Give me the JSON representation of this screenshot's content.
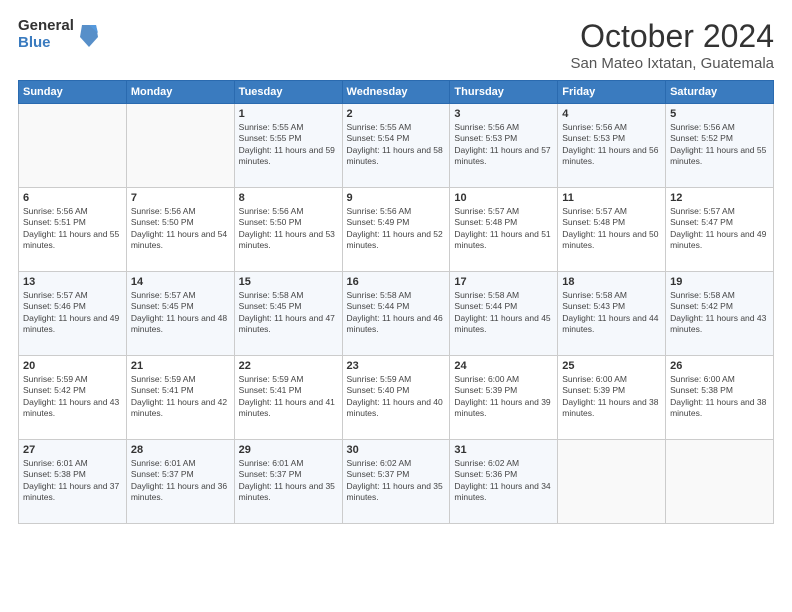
{
  "logo": {
    "general": "General",
    "blue": "Blue"
  },
  "header": {
    "month": "October 2024",
    "location": "San Mateo Ixtatan, Guatemala"
  },
  "weekdays": [
    "Sunday",
    "Monday",
    "Tuesday",
    "Wednesday",
    "Thursday",
    "Friday",
    "Saturday"
  ],
  "weeks": [
    [
      {
        "day": "",
        "info": ""
      },
      {
        "day": "",
        "info": ""
      },
      {
        "day": "1",
        "info": "Sunrise: 5:55 AM\nSunset: 5:55 PM\nDaylight: 11 hours and 59 minutes."
      },
      {
        "day": "2",
        "info": "Sunrise: 5:55 AM\nSunset: 5:54 PM\nDaylight: 11 hours and 58 minutes."
      },
      {
        "day": "3",
        "info": "Sunrise: 5:56 AM\nSunset: 5:53 PM\nDaylight: 11 hours and 57 minutes."
      },
      {
        "day": "4",
        "info": "Sunrise: 5:56 AM\nSunset: 5:53 PM\nDaylight: 11 hours and 56 minutes."
      },
      {
        "day": "5",
        "info": "Sunrise: 5:56 AM\nSunset: 5:52 PM\nDaylight: 11 hours and 55 minutes."
      }
    ],
    [
      {
        "day": "6",
        "info": "Sunrise: 5:56 AM\nSunset: 5:51 PM\nDaylight: 11 hours and 55 minutes."
      },
      {
        "day": "7",
        "info": "Sunrise: 5:56 AM\nSunset: 5:50 PM\nDaylight: 11 hours and 54 minutes."
      },
      {
        "day": "8",
        "info": "Sunrise: 5:56 AM\nSunset: 5:50 PM\nDaylight: 11 hours and 53 minutes."
      },
      {
        "day": "9",
        "info": "Sunrise: 5:56 AM\nSunset: 5:49 PM\nDaylight: 11 hours and 52 minutes."
      },
      {
        "day": "10",
        "info": "Sunrise: 5:57 AM\nSunset: 5:48 PM\nDaylight: 11 hours and 51 minutes."
      },
      {
        "day": "11",
        "info": "Sunrise: 5:57 AM\nSunset: 5:48 PM\nDaylight: 11 hours and 50 minutes."
      },
      {
        "day": "12",
        "info": "Sunrise: 5:57 AM\nSunset: 5:47 PM\nDaylight: 11 hours and 49 minutes."
      }
    ],
    [
      {
        "day": "13",
        "info": "Sunrise: 5:57 AM\nSunset: 5:46 PM\nDaylight: 11 hours and 49 minutes."
      },
      {
        "day": "14",
        "info": "Sunrise: 5:57 AM\nSunset: 5:45 PM\nDaylight: 11 hours and 48 minutes."
      },
      {
        "day": "15",
        "info": "Sunrise: 5:58 AM\nSunset: 5:45 PM\nDaylight: 11 hours and 47 minutes."
      },
      {
        "day": "16",
        "info": "Sunrise: 5:58 AM\nSunset: 5:44 PM\nDaylight: 11 hours and 46 minutes."
      },
      {
        "day": "17",
        "info": "Sunrise: 5:58 AM\nSunset: 5:44 PM\nDaylight: 11 hours and 45 minutes."
      },
      {
        "day": "18",
        "info": "Sunrise: 5:58 AM\nSunset: 5:43 PM\nDaylight: 11 hours and 44 minutes."
      },
      {
        "day": "19",
        "info": "Sunrise: 5:58 AM\nSunset: 5:42 PM\nDaylight: 11 hours and 43 minutes."
      }
    ],
    [
      {
        "day": "20",
        "info": "Sunrise: 5:59 AM\nSunset: 5:42 PM\nDaylight: 11 hours and 43 minutes."
      },
      {
        "day": "21",
        "info": "Sunrise: 5:59 AM\nSunset: 5:41 PM\nDaylight: 11 hours and 42 minutes."
      },
      {
        "day": "22",
        "info": "Sunrise: 5:59 AM\nSunset: 5:41 PM\nDaylight: 11 hours and 41 minutes."
      },
      {
        "day": "23",
        "info": "Sunrise: 5:59 AM\nSunset: 5:40 PM\nDaylight: 11 hours and 40 minutes."
      },
      {
        "day": "24",
        "info": "Sunrise: 6:00 AM\nSunset: 5:39 PM\nDaylight: 11 hours and 39 minutes."
      },
      {
        "day": "25",
        "info": "Sunrise: 6:00 AM\nSunset: 5:39 PM\nDaylight: 11 hours and 38 minutes."
      },
      {
        "day": "26",
        "info": "Sunrise: 6:00 AM\nSunset: 5:38 PM\nDaylight: 11 hours and 38 minutes."
      }
    ],
    [
      {
        "day": "27",
        "info": "Sunrise: 6:01 AM\nSunset: 5:38 PM\nDaylight: 11 hours and 37 minutes."
      },
      {
        "day": "28",
        "info": "Sunrise: 6:01 AM\nSunset: 5:37 PM\nDaylight: 11 hours and 36 minutes."
      },
      {
        "day": "29",
        "info": "Sunrise: 6:01 AM\nSunset: 5:37 PM\nDaylight: 11 hours and 35 minutes."
      },
      {
        "day": "30",
        "info": "Sunrise: 6:02 AM\nSunset: 5:37 PM\nDaylight: 11 hours and 35 minutes."
      },
      {
        "day": "31",
        "info": "Sunrise: 6:02 AM\nSunset: 5:36 PM\nDaylight: 11 hours and 34 minutes."
      },
      {
        "day": "",
        "info": ""
      },
      {
        "day": "",
        "info": ""
      }
    ]
  ]
}
